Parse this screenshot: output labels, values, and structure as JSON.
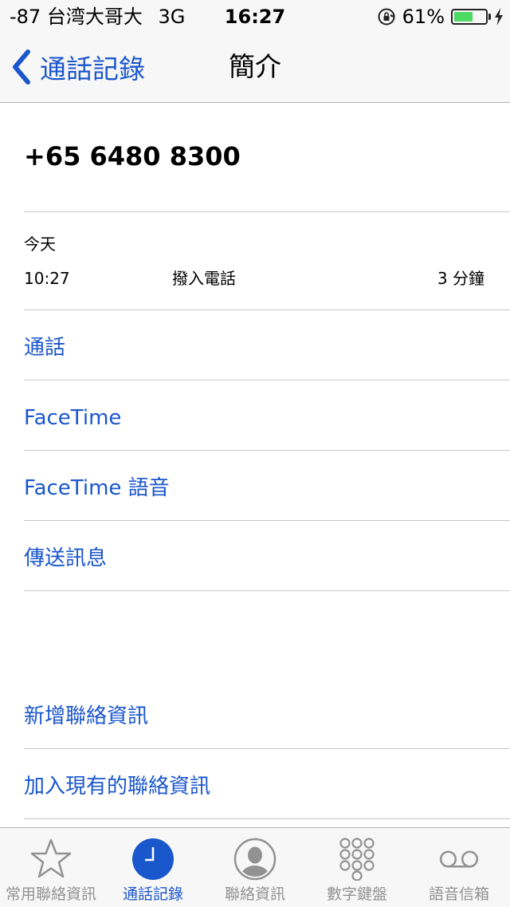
{
  "status_bar": {
    "signal": "-87",
    "carrier": "台湾大哥大",
    "network": "3G",
    "time": "16:27",
    "battery_percent": "61%",
    "battery_level": 0.61
  },
  "nav": {
    "back_label": "通話記錄",
    "title": "簡介"
  },
  "contact": {
    "phone_number": "+65 6480 8300"
  },
  "call_log": {
    "date_label": "今天",
    "entries": [
      {
        "time": "10:27",
        "type": "撥入電話",
        "duration": "3 分鐘"
      }
    ]
  },
  "actions": [
    {
      "label": "通話"
    },
    {
      "label": "FaceTime"
    },
    {
      "label": "FaceTime 語音"
    },
    {
      "label": "傳送訊息"
    }
  ],
  "contact_actions": [
    {
      "label": "新增聯絡資訊"
    },
    {
      "label": "加入現有的聯絡資訊"
    }
  ],
  "tabs": [
    {
      "label": "常用聯絡資訊",
      "icon": "star-icon",
      "active": false
    },
    {
      "label": "通話記錄",
      "icon": "clock-icon",
      "active": true
    },
    {
      "label": "聯絡資訊",
      "icon": "contact-icon",
      "active": false
    },
    {
      "label": "數字鍵盤",
      "icon": "keypad-icon",
      "active": false
    },
    {
      "label": "語音信箱",
      "icon": "voicemail-icon",
      "active": false
    }
  ],
  "colors": {
    "accent": "#1a56cc",
    "battery": "#4cd964",
    "tab_inactive": "#929292",
    "separator": "#c8c7cc"
  }
}
